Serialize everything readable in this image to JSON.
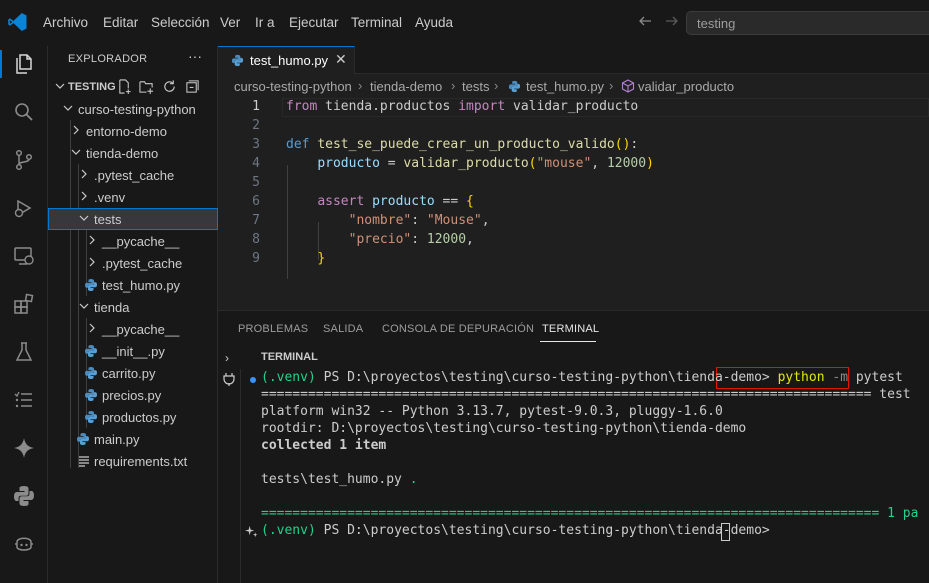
{
  "menu": [
    "Archivo",
    "Editar",
    "Selección",
    "Ver",
    "Ir a",
    "Ejecutar",
    "Terminal",
    "Ayuda"
  ],
  "search": {
    "value": "testing"
  },
  "sidebar": {
    "title": "EXPLORADOR",
    "more": "···",
    "root": "TESTING",
    "tree": [
      "curso-testing-python",
      "entorno-demo",
      "tienda-demo",
      ".pytest_cache",
      ".venv",
      "tests",
      "__pycache__",
      ".pytest_cache",
      "test_humo.py",
      "tienda",
      "__pycache__",
      "__init__.py",
      "carrito.py",
      "precios.py",
      "productos.py",
      "main.py",
      "requirements.txt"
    ]
  },
  "tab": {
    "label": "test_humo.py",
    "close": "✕"
  },
  "breadcrumb": [
    "curso-testing-python",
    "tienda-demo",
    "tests",
    "test_humo.py",
    "validar_producto"
  ],
  "code": {
    "line_numbers": [
      "1",
      "2",
      "3",
      "4",
      "5",
      "6",
      "7",
      "8",
      "9"
    ],
    "l1": {
      "from": "from",
      "mod": " tienda.productos ",
      "import": "import",
      "name": " validar_producto"
    },
    "l3": {
      "def": "def",
      "fn": "test_se_puede_crear_un_producto_valido",
      "open": "(",
      "close": ")",
      "colon": ":"
    },
    "l4": {
      "var": "producto",
      "eq": " = ",
      "fn": "validar_producto",
      "open": "(",
      "s": "\"mouse\"",
      "comma": ", ",
      "n": "12000",
      "close": ")"
    },
    "l6": {
      "assert": "assert",
      "var": " producto",
      "eq": " == ",
      "brace": "{"
    },
    "l7": {
      "key": "\"nombre\"",
      "colon": ": ",
      "val": "\"Mouse\"",
      "comma": ","
    },
    "l8": {
      "key": "\"precio\"",
      "colon": ": ",
      "val": "12000",
      "comma": ","
    },
    "l9": {
      "brace": "}"
    }
  },
  "panel": {
    "tabs": [
      "PROBLEMAS",
      "SALIDA",
      "CONSOLA DE DEPURACIÓN",
      "TERMINAL"
    ],
    "section_title": "TERMINAL"
  },
  "terminal": {
    "prompt_venv": "(.venv)",
    "prompt_path": " PS D:\\proyectos\\testing\\curso-testing-python\\tienda-demo> ",
    "cmd_python": "python",
    "cmd_flag": " -m",
    "cmd_rest": " pytest",
    "sep_header": "============================================================================== test",
    "platform": "platform win32 -- Python 3.13.7, pytest-9.0.3, pluggy-1.6.0",
    "rootdir": "rootdir: D:\\proyectos\\testing\\curso-testing-python\\tienda-demo",
    "collected": "collected 1 item",
    "test_file": "tests\\test_humo.py ",
    "test_dot": ".",
    "sep_footer": "=============================================================================== 1 pa",
    "prompt2_venv": "(.venv)",
    "prompt2_path": " PS D:\\proyectos\\testing\\curso-testing-python\\tienda-demo> "
  },
  "colors": {
    "accent": "#0078d4",
    "pass_green": "#23d18b",
    "highlight_red": "#e51400"
  }
}
